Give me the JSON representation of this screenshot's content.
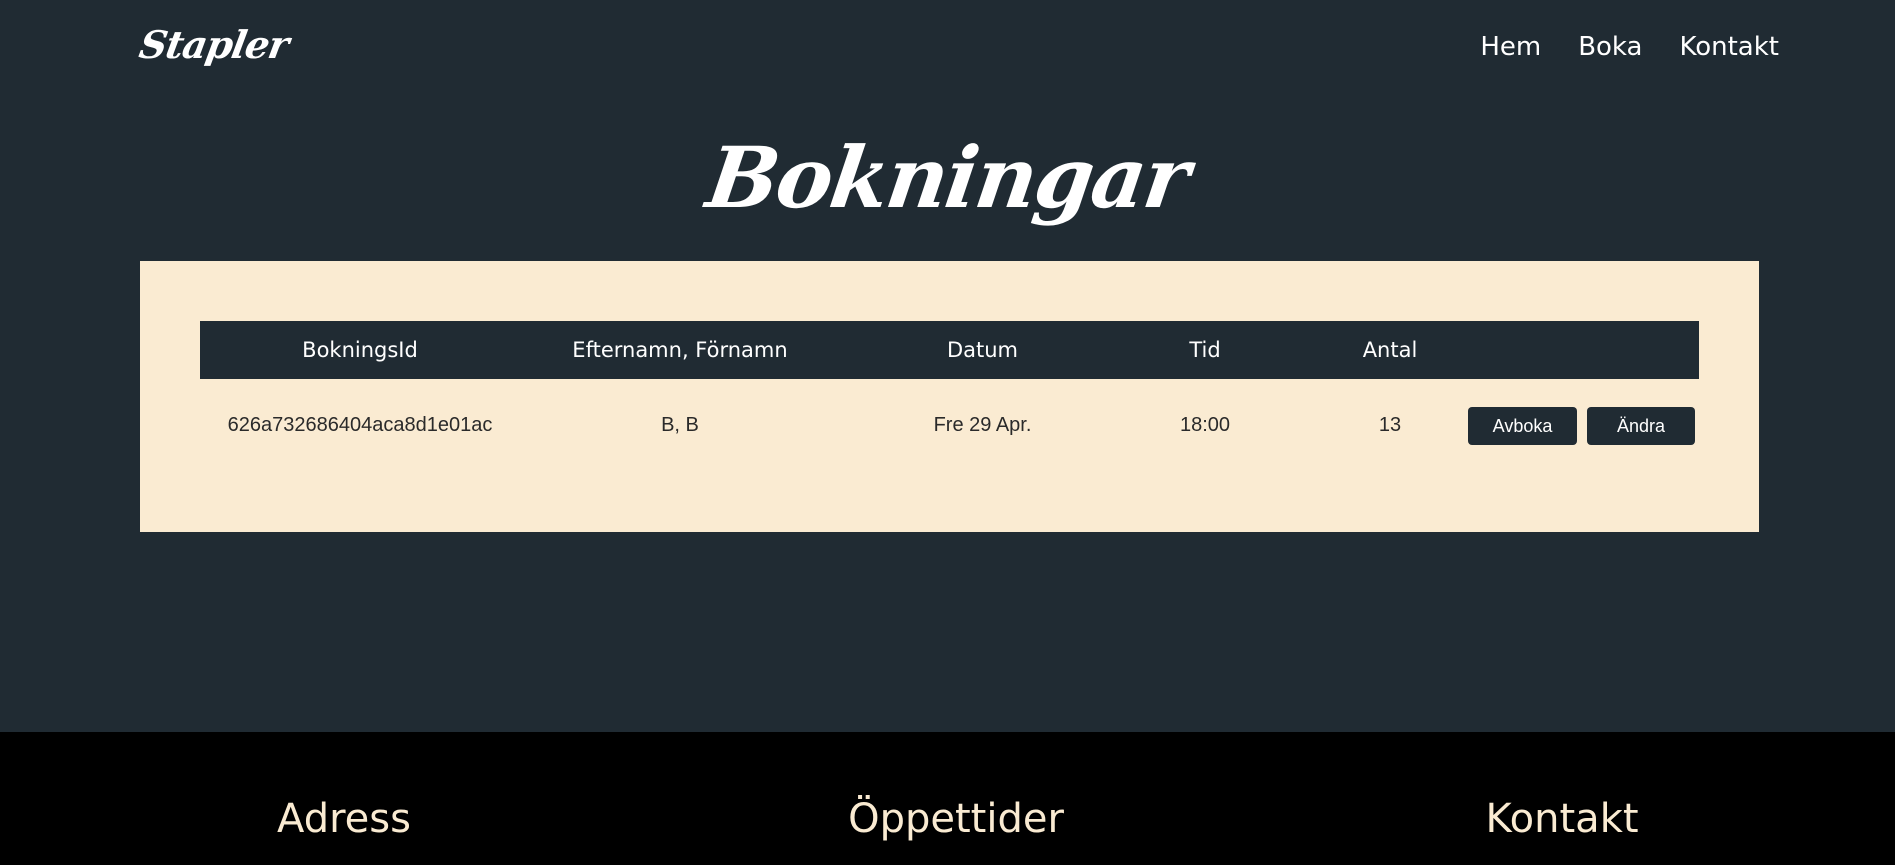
{
  "header": {
    "logo": "Stapler",
    "nav": [
      "Hem",
      "Boka",
      "Kontakt"
    ]
  },
  "main": {
    "title": "Bokningar",
    "table": {
      "headers": [
        "BokningsId",
        "Efternamn, Förnamn",
        "Datum",
        "Tid",
        "Antal"
      ],
      "rows": [
        {
          "id": "626a732686404aca8d1e01ac",
          "name": "B, B",
          "date": "Fre 29 Apr.",
          "time": "18:00",
          "count": "13",
          "cancel_label": "Avboka",
          "edit_label": "Ändra"
        }
      ]
    }
  },
  "footer": {
    "headings": [
      "Adress",
      "Öppettider",
      "Kontakt"
    ]
  },
  "colors": {
    "background": "#202b33",
    "card": "#faebd2",
    "footer": "#000000",
    "footer_text": "#faebd2"
  }
}
